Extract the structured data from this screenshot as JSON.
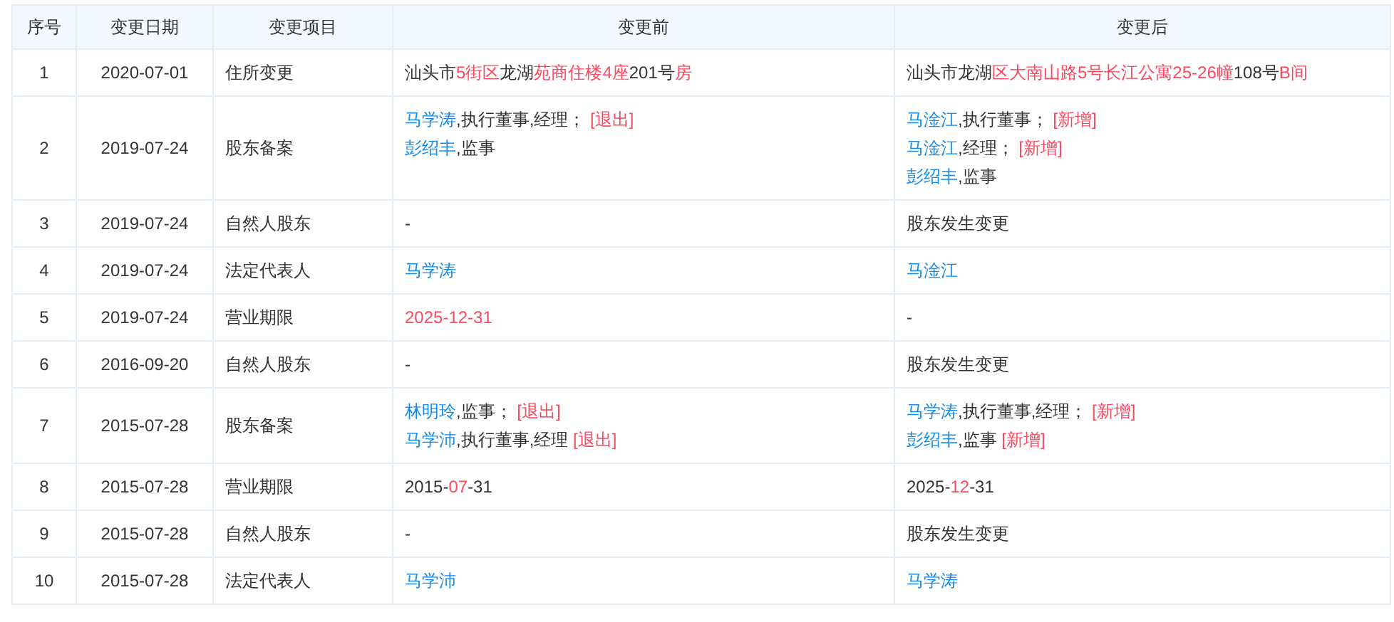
{
  "table": {
    "columns": [
      "序号",
      "变更日期",
      "变更项目",
      "变更前",
      "变更后"
    ],
    "rows": [
      {
        "index": "1",
        "date": "2020-07-01",
        "item": "住所变更",
        "before": [
          [
            {
              "text": "汕头市",
              "kind": "text"
            },
            {
              "text": "5街区",
              "kind": "highlight"
            },
            {
              "text": "龙湖",
              "kind": "text"
            },
            {
              "text": "苑商住楼4座",
              "kind": "highlight"
            },
            {
              "text": "201号",
              "kind": "text"
            },
            {
              "text": "房",
              "kind": "highlight"
            }
          ]
        ],
        "after": [
          [
            {
              "text": "汕头市龙湖",
              "kind": "text"
            },
            {
              "text": "区大南山路5号长江公寓25-26幢",
              "kind": "highlight"
            },
            {
              "text": "108号",
              "kind": "text"
            },
            {
              "text": "B间",
              "kind": "highlight"
            }
          ]
        ]
      },
      {
        "index": "2",
        "date": "2019-07-24",
        "item": "股东备案",
        "before": [
          [
            {
              "text": "马学涛",
              "kind": "link"
            },
            {
              "text": ",执行董事,经理； ",
              "kind": "text"
            },
            {
              "text": "[退出]",
              "kind": "highlight"
            }
          ],
          [
            {
              "text": "彭绍丰",
              "kind": "link"
            },
            {
              "text": ",监事",
              "kind": "text"
            }
          ]
        ],
        "after": [
          [
            {
              "text": "马淦江",
              "kind": "link"
            },
            {
              "text": ",执行董事； ",
              "kind": "text"
            },
            {
              "text": "[新增]",
              "kind": "highlight"
            }
          ],
          [
            {
              "text": "马淦江",
              "kind": "link"
            },
            {
              "text": ",经理； ",
              "kind": "text"
            },
            {
              "text": "[新增]",
              "kind": "highlight"
            }
          ],
          [
            {
              "text": "彭绍丰",
              "kind": "link"
            },
            {
              "text": ",监事",
              "kind": "text"
            }
          ]
        ]
      },
      {
        "index": "3",
        "date": "2019-07-24",
        "item": "自然人股东",
        "before": [
          [
            {
              "text": "-",
              "kind": "text"
            }
          ]
        ],
        "after": [
          [
            {
              "text": "股东发生变更",
              "kind": "text"
            }
          ]
        ]
      },
      {
        "index": "4",
        "date": "2019-07-24",
        "item": "法定代表人",
        "before": [
          [
            {
              "text": "马学涛",
              "kind": "link"
            }
          ]
        ],
        "after": [
          [
            {
              "text": "马淦江",
              "kind": "link"
            }
          ]
        ]
      },
      {
        "index": "5",
        "date": "2019-07-24",
        "item": "营业期限",
        "before": [
          [
            {
              "text": "2025-12-31",
              "kind": "highlight"
            }
          ]
        ],
        "after": [
          [
            {
              "text": "-",
              "kind": "text"
            }
          ]
        ]
      },
      {
        "index": "6",
        "date": "2016-09-20",
        "item": "自然人股东",
        "before": [
          [
            {
              "text": "-",
              "kind": "text"
            }
          ]
        ],
        "after": [
          [
            {
              "text": "股东发生变更",
              "kind": "text"
            }
          ]
        ]
      },
      {
        "index": "7",
        "date": "2015-07-28",
        "item": "股东备案",
        "before": [
          [
            {
              "text": "林明玲",
              "kind": "link"
            },
            {
              "text": ",监事； ",
              "kind": "text"
            },
            {
              "text": "[退出]",
              "kind": "highlight"
            }
          ],
          [
            {
              "text": "马学沛",
              "kind": "link"
            },
            {
              "text": ",执行董事,经理 ",
              "kind": "text"
            },
            {
              "text": "[退出]",
              "kind": "highlight"
            }
          ]
        ],
        "after": [
          [
            {
              "text": "马学涛",
              "kind": "link"
            },
            {
              "text": ",执行董事,经理； ",
              "kind": "text"
            },
            {
              "text": "[新增]",
              "kind": "highlight"
            }
          ],
          [
            {
              "text": "彭绍丰",
              "kind": "link"
            },
            {
              "text": ",监事 ",
              "kind": "text"
            },
            {
              "text": "[新增]",
              "kind": "highlight"
            }
          ]
        ]
      },
      {
        "index": "8",
        "date": "2015-07-28",
        "item": "营业期限",
        "before": [
          [
            {
              "text": "2015-",
              "kind": "text"
            },
            {
              "text": "07",
              "kind": "highlight"
            },
            {
              "text": "-31",
              "kind": "text"
            }
          ]
        ],
        "after": [
          [
            {
              "text": "2025-",
              "kind": "text"
            },
            {
              "text": "12",
              "kind": "highlight"
            },
            {
              "text": "-31",
              "kind": "text"
            }
          ]
        ]
      },
      {
        "index": "9",
        "date": "2015-07-28",
        "item": "自然人股东",
        "before": [
          [
            {
              "text": "-",
              "kind": "text"
            }
          ]
        ],
        "after": [
          [
            {
              "text": "股东发生变更",
              "kind": "text"
            }
          ]
        ]
      },
      {
        "index": "10",
        "date": "2015-07-28",
        "item": "法定代表人",
        "before": [
          [
            {
              "text": "马学沛",
              "kind": "link"
            }
          ]
        ],
        "after": [
          [
            {
              "text": "马学涛",
              "kind": "link"
            }
          ]
        ]
      }
    ]
  }
}
